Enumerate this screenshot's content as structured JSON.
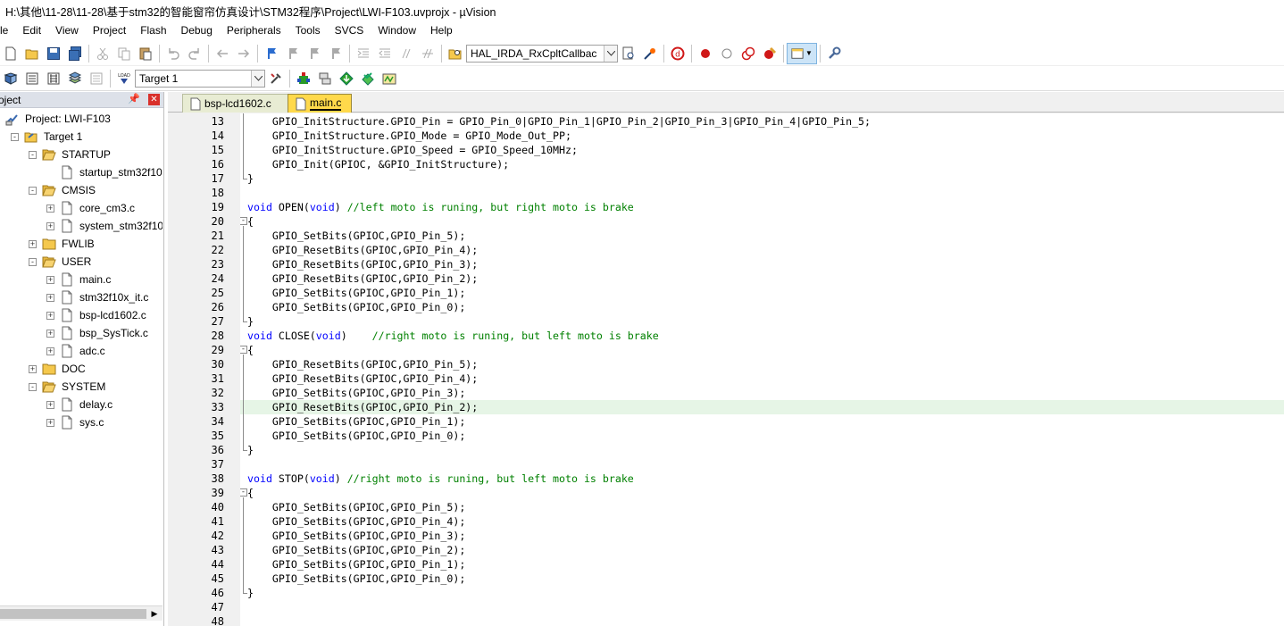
{
  "window": {
    "title": "H:\\其他\\11-28\\11-28\\基于stm32的智能窗帘仿真设计\\STM32程序\\Project\\LWI-F103.uvprojx - µVision"
  },
  "menu": [
    "le",
    "Edit",
    "View",
    "Project",
    "Flash",
    "Debug",
    "Peripherals",
    "Tools",
    "SVCS",
    "Window",
    "Help"
  ],
  "toolbar1": {
    "find_combo": "HAL_IRDA_RxCpltCallbac"
  },
  "toolbar2": {
    "target_combo": "Target 1"
  },
  "project_panel": {
    "title": "oject",
    "pin_glyph": "—❘",
    "close_glyph": "x",
    "tree": [
      {
        "label": "Project: LWI-F103",
        "level": 0,
        "icon": "project-icon",
        "expander": ""
      },
      {
        "label": "Target 1",
        "level": 1,
        "icon": "target-folder-icon",
        "expander": "-"
      },
      {
        "label": "STARTUP",
        "level": 2,
        "icon": "folder-open-icon",
        "expander": "-"
      },
      {
        "label": "startup_stm32f10",
        "level": 3,
        "icon": "file-icon",
        "expander": ""
      },
      {
        "label": "CMSIS",
        "level": 2,
        "icon": "folder-open-icon",
        "expander": "-"
      },
      {
        "label": "core_cm3.c",
        "level": 3,
        "icon": "file-icon",
        "expander": "+"
      },
      {
        "label": "system_stm32f10",
        "level": 3,
        "icon": "file-icon",
        "expander": "+"
      },
      {
        "label": "FWLIB",
        "level": 2,
        "icon": "folder-closed-icon",
        "expander": "+"
      },
      {
        "label": "USER",
        "level": 2,
        "icon": "folder-open-icon",
        "expander": "-"
      },
      {
        "label": "main.c",
        "level": 3,
        "icon": "file-icon",
        "expander": "+"
      },
      {
        "label": "stm32f10x_it.c",
        "level": 3,
        "icon": "file-icon",
        "expander": "+"
      },
      {
        "label": "bsp-lcd1602.c",
        "level": 3,
        "icon": "file-icon",
        "expander": "+"
      },
      {
        "label": "bsp_SysTick.c",
        "level": 3,
        "icon": "file-icon",
        "expander": "+"
      },
      {
        "label": "adc.c",
        "level": 3,
        "icon": "file-icon",
        "expander": "+"
      },
      {
        "label": "DOC",
        "level": 2,
        "icon": "folder-closed-icon",
        "expander": "+"
      },
      {
        "label": "SYSTEM",
        "level": 2,
        "icon": "folder-open-icon",
        "expander": "-"
      },
      {
        "label": "delay.c",
        "level": 3,
        "icon": "file-icon",
        "expander": "+"
      },
      {
        "label": "sys.c",
        "level": 3,
        "icon": "file-icon",
        "expander": "+"
      }
    ]
  },
  "editor": {
    "tabs": [
      {
        "label": "bsp-lcd1602.c",
        "active": false
      },
      {
        "label": "main.c",
        "active": true
      }
    ],
    "highlighted_line": 33,
    "lines": [
      {
        "n": "13",
        "segs": [
          [
            "pl",
            "    GPIO_InitStructure.GPIO_Pin = GPIO_Pin_0|GPIO_Pin_1|GPIO_Pin_2|GPIO_Pin_3|GPIO_Pin_4|GPIO_Pin_5;"
          ]
        ]
      },
      {
        "n": "14",
        "segs": [
          [
            "pl",
            "    GPIO_InitStructure.GPIO_Mode = GPIO_Mode_Out_PP;"
          ]
        ]
      },
      {
        "n": "15",
        "segs": [
          [
            "pl",
            "    GPIO_InitStructure.GPIO_Speed = GPIO_Speed_10MHz;"
          ]
        ]
      },
      {
        "n": "16",
        "segs": [
          [
            "pl",
            "    GPIO_Init(GPIOC, &GPIO_InitStructure);"
          ]
        ]
      },
      {
        "n": "17",
        "segs": [
          [
            "pl",
            "}"
          ]
        ]
      },
      {
        "n": "18",
        "segs": [
          [
            "pl",
            ""
          ]
        ]
      },
      {
        "n": "19",
        "segs": [
          [
            "kw",
            "void"
          ],
          [
            "pl",
            " OPEN("
          ],
          [
            "kw",
            "void"
          ],
          [
            "pl",
            ") "
          ],
          [
            "cm",
            "//left moto is runing, but right moto is brake"
          ]
        ]
      },
      {
        "n": "20",
        "segs": [
          [
            "pl",
            "{"
          ]
        ]
      },
      {
        "n": "21",
        "segs": [
          [
            "pl",
            "    GPIO_SetBits(GPIOC,GPIO_Pin_5);"
          ]
        ]
      },
      {
        "n": "22",
        "segs": [
          [
            "pl",
            "    GPIO_ResetBits(GPIOC,GPIO_Pin_4);"
          ]
        ]
      },
      {
        "n": "23",
        "segs": [
          [
            "pl",
            "    GPIO_ResetBits(GPIOC,GPIO_Pin_3);"
          ]
        ]
      },
      {
        "n": "24",
        "segs": [
          [
            "pl",
            "    GPIO_ResetBits(GPIOC,GPIO_Pin_2);"
          ]
        ]
      },
      {
        "n": "25",
        "segs": [
          [
            "pl",
            "    GPIO_SetBits(GPIOC,GPIO_Pin_1);"
          ]
        ]
      },
      {
        "n": "26",
        "segs": [
          [
            "pl",
            "    GPIO_SetBits(GPIOC,GPIO_Pin_0);"
          ]
        ]
      },
      {
        "n": "27",
        "segs": [
          [
            "pl",
            "}"
          ]
        ]
      },
      {
        "n": "28",
        "segs": [
          [
            "kw",
            "void"
          ],
          [
            "pl",
            " CLOSE("
          ],
          [
            "kw",
            "void"
          ],
          [
            "pl",
            ")    "
          ],
          [
            "cm",
            "//right moto is runing, but left moto is brake"
          ]
        ]
      },
      {
        "n": "29",
        "segs": [
          [
            "pl",
            "{"
          ]
        ]
      },
      {
        "n": "30",
        "segs": [
          [
            "pl",
            "    GPIO_ResetBits(GPIOC,GPIO_Pin_5);"
          ]
        ]
      },
      {
        "n": "31",
        "segs": [
          [
            "pl",
            "    GPIO_ResetBits(GPIOC,GPIO_Pin_4);"
          ]
        ]
      },
      {
        "n": "32",
        "segs": [
          [
            "pl",
            "    GPIO_SetBits(GPIOC,GPIO_Pin_3);"
          ]
        ]
      },
      {
        "n": "33",
        "segs": [
          [
            "pl",
            "    GPIO_ResetBits(GPIOC,GPIO_Pin_2);"
          ]
        ]
      },
      {
        "n": "34",
        "segs": [
          [
            "pl",
            "    GPIO_SetBits(GPIOC,GPIO_Pin_1);"
          ]
        ]
      },
      {
        "n": "35",
        "segs": [
          [
            "pl",
            "    GPIO_SetBits(GPIOC,GPIO_Pin_0);"
          ]
        ]
      },
      {
        "n": "36",
        "segs": [
          [
            "pl",
            "}"
          ]
        ]
      },
      {
        "n": "37",
        "segs": [
          [
            "pl",
            ""
          ]
        ]
      },
      {
        "n": "38",
        "segs": [
          [
            "kw",
            "void"
          ],
          [
            "pl",
            " STOP("
          ],
          [
            "kw",
            "void"
          ],
          [
            "pl",
            ") "
          ],
          [
            "cm",
            "//right moto is runing, but left moto is brake"
          ]
        ]
      },
      {
        "n": "39",
        "segs": [
          [
            "pl",
            "{"
          ]
        ]
      },
      {
        "n": "40",
        "segs": [
          [
            "pl",
            "    GPIO_SetBits(GPIOC,GPIO_Pin_5);"
          ]
        ]
      },
      {
        "n": "41",
        "segs": [
          [
            "pl",
            "    GPIO_SetBits(GPIOC,GPIO_Pin_4);"
          ]
        ]
      },
      {
        "n": "42",
        "segs": [
          [
            "pl",
            "    GPIO_SetBits(GPIOC,GPIO_Pin_3);"
          ]
        ]
      },
      {
        "n": "43",
        "segs": [
          [
            "pl",
            "    GPIO_SetBits(GPIOC,GPIO_Pin_2);"
          ]
        ]
      },
      {
        "n": "44",
        "segs": [
          [
            "pl",
            "    GPIO_SetBits(GPIOC,GPIO_Pin_1);"
          ]
        ]
      },
      {
        "n": "45",
        "segs": [
          [
            "pl",
            "    GPIO_SetBits(GPIOC,GPIO_Pin_0);"
          ]
        ]
      },
      {
        "n": "46",
        "segs": [
          [
            "pl",
            "}"
          ]
        ]
      },
      {
        "n": "47",
        "segs": [
          [
            "pl",
            ""
          ]
        ]
      },
      {
        "n": "48",
        "segs": [
          [
            "pl",
            ""
          ]
        ]
      }
    ]
  },
  "colors": {
    "keyword": "#0000ff",
    "comment": "#008000",
    "highlight_line": "#e6f5e6",
    "active_tab": "#ffd94b"
  }
}
